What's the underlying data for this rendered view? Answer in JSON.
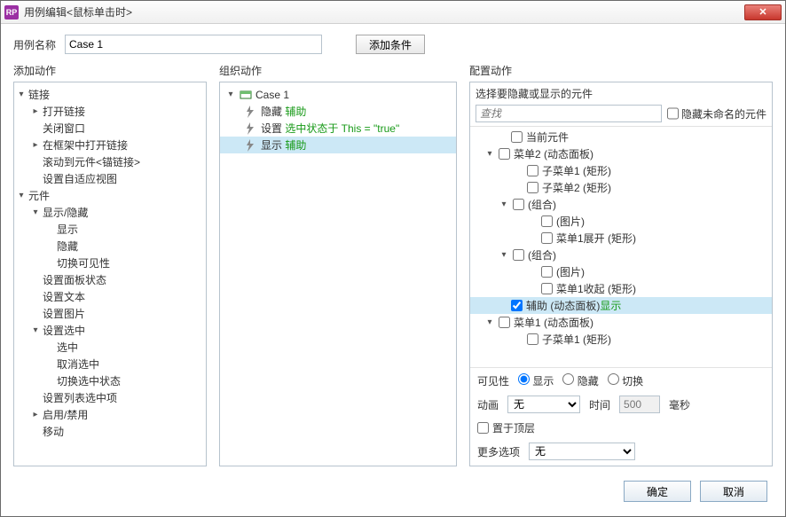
{
  "window": {
    "title": "用例编辑<鼠标单击时>",
    "app_icon_text": "RP",
    "close_label": "✕"
  },
  "top": {
    "case_name_label": "用例名称",
    "case_name_value": "Case 1",
    "add_condition_label": "添加条件"
  },
  "cols": {
    "left_title": "添加动作",
    "mid_title": "组织动作",
    "right_title": "配置动作"
  },
  "left_tree": [
    {
      "d": 0,
      "t": "▾",
      "l": "链接"
    },
    {
      "d": 1,
      "t": "▸",
      "l": "打开链接"
    },
    {
      "d": 1,
      "t": "",
      "l": "关闭窗口"
    },
    {
      "d": 1,
      "t": "▸",
      "l": "在框架中打开链接"
    },
    {
      "d": 1,
      "t": "",
      "l": "滚动到元件<锚链接>"
    },
    {
      "d": 1,
      "t": "",
      "l": "设置自适应视图"
    },
    {
      "d": 0,
      "t": "▾",
      "l": "元件"
    },
    {
      "d": 1,
      "t": "▾",
      "l": "显示/隐藏"
    },
    {
      "d": 2,
      "t": "",
      "l": "显示"
    },
    {
      "d": 2,
      "t": "",
      "l": "隐藏"
    },
    {
      "d": 2,
      "t": "",
      "l": "切换可见性"
    },
    {
      "d": 1,
      "t": "",
      "l": "设置面板状态"
    },
    {
      "d": 1,
      "t": "",
      "l": "设置文本"
    },
    {
      "d": 1,
      "t": "",
      "l": "设置图片"
    },
    {
      "d": 1,
      "t": "▾",
      "l": "设置选中"
    },
    {
      "d": 2,
      "t": "",
      "l": "选中"
    },
    {
      "d": 2,
      "t": "",
      "l": "取消选中"
    },
    {
      "d": 2,
      "t": "",
      "l": "切换选中状态"
    },
    {
      "d": 1,
      "t": "",
      "l": "设置列表选中项"
    },
    {
      "d": 1,
      "t": "▸",
      "l": "启用/禁用"
    },
    {
      "d": 1,
      "t": "",
      "l": "移动"
    }
  ],
  "mid_tree": {
    "case_label": "Case 1",
    "items": [
      {
        "kind": "bolt",
        "pre": "隐藏 ",
        "green": "辅助",
        "post": "",
        "sel": false
      },
      {
        "kind": "bolt",
        "pre": "设置 ",
        "green": "选中状态于 This = \"true\"",
        "post": "",
        "sel": false
      },
      {
        "kind": "bolt",
        "pre": "显示 ",
        "green": "辅助",
        "post": "",
        "sel": true
      }
    ]
  },
  "right": {
    "subtitle": "选择要隐藏或显示的元件",
    "search_placeholder": "查找",
    "hide_unnamed_label": "隐藏未命名的元件",
    "tree": [
      {
        "pad": 30,
        "t": "",
        "cb": false,
        "l": "当前元件"
      },
      {
        "pad": 16,
        "t": "▾",
        "cb": false,
        "l": "菜单2 (动态面板)"
      },
      {
        "pad": 48,
        "t": "",
        "cb": false,
        "l": "子菜单1 (矩形)"
      },
      {
        "pad": 48,
        "t": "",
        "cb": false,
        "l": "子菜单2 (矩形)"
      },
      {
        "pad": 32,
        "t": "▾",
        "cb": false,
        "l": "(组合)"
      },
      {
        "pad": 64,
        "t": "",
        "cb": false,
        "l": "(图片)"
      },
      {
        "pad": 64,
        "t": "",
        "cb": false,
        "l": "菜单1展开 (矩形)"
      },
      {
        "pad": 32,
        "t": "▾",
        "cb": false,
        "l": "(组合)"
      },
      {
        "pad": 64,
        "t": "",
        "cb": false,
        "l": "(图片)"
      },
      {
        "pad": 64,
        "t": "",
        "cb": false,
        "l": "菜单1收起 (矩形)"
      },
      {
        "pad": 30,
        "t": "",
        "cb": true,
        "l": "辅助 (动态面板) ",
        "g": "显示",
        "sel": true
      },
      {
        "pad": 16,
        "t": "▾",
        "cb": false,
        "l": "菜单1 (动态面板)"
      },
      {
        "pad": 48,
        "t": "",
        "cb": false,
        "l": "子菜单1 (矩形)"
      }
    ],
    "opts": {
      "vis_label": "可见性",
      "vis_show": "显示",
      "vis_hide": "隐藏",
      "vis_toggle": "切换",
      "anim_label": "动画",
      "anim_value": "无",
      "time_label": "时间",
      "time_value": "500",
      "time_unit": "毫秒",
      "top_label": "置于顶层",
      "more_label": "更多选项",
      "more_value": "无"
    }
  },
  "footer": {
    "ok": "确定",
    "cancel": "取消"
  }
}
